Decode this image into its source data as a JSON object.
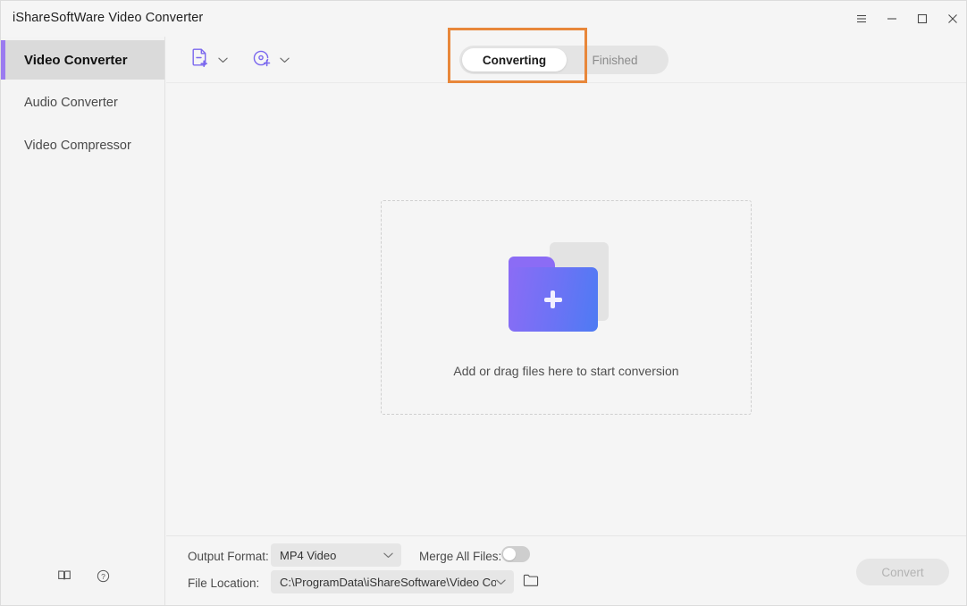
{
  "window": {
    "title": "iShareSoftWare Video Converter",
    "controls": [
      {
        "name": "menu-button",
        "icon": "hamburger-menu-icon"
      },
      {
        "name": "minimize-button",
        "icon": "minimize-icon"
      },
      {
        "name": "maximize-button",
        "icon": "maximize-icon"
      },
      {
        "name": "close-button",
        "icon": "close-icon"
      }
    ]
  },
  "sidebar": {
    "items": [
      {
        "label": "Video Converter",
        "active": true
      },
      {
        "label": "Audio Converter",
        "active": false
      },
      {
        "label": "Video Compressor",
        "active": false
      }
    ],
    "footer_icons": [
      {
        "name": "book-icon"
      },
      {
        "name": "help-circle-icon"
      }
    ],
    "accent_color": "#9b7bf0"
  },
  "toolbar": {
    "add_file": {
      "label": "Add Files",
      "icon": "add-file-icon"
    },
    "add_dvd": {
      "label": "Add DVD",
      "icon": "add-disc-icon"
    },
    "icon_color": "#7b68ee",
    "tabs": [
      {
        "label": "Converting",
        "active": true
      },
      {
        "label": "Finished",
        "active": false
      }
    ]
  },
  "annotation": {
    "color": "#e8873a",
    "target": "Converting"
  },
  "dropzone": {
    "caption": "Add or drag files here to start conversion",
    "icon": "add-folder-icon",
    "gradient_from": "#8b6cf5",
    "gradient_to": "#4d7bf3"
  },
  "bottom": {
    "output_format_label": "Output Format:",
    "output_format_value": "MP4 Video",
    "merge_label": "Merge All Files:",
    "merge_enabled": false,
    "file_location_label": "File Location:",
    "file_location_value": "C:\\ProgramData\\iShareSoftware\\Video Conve",
    "browse_icon": "folder-icon",
    "convert_label": "Convert",
    "convert_enabled": false
  }
}
